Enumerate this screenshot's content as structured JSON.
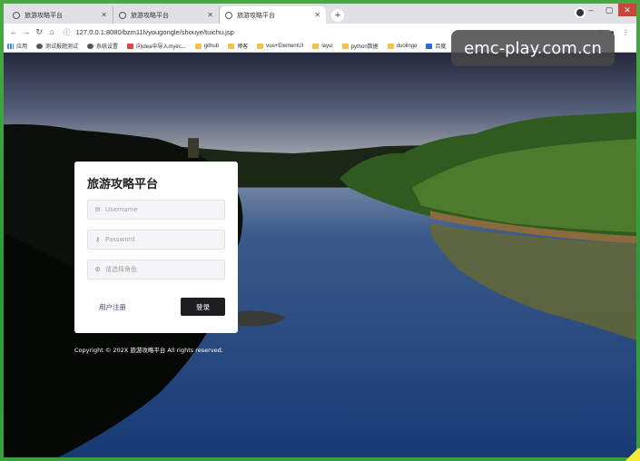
{
  "browser": {
    "tabs": [
      {
        "title": "旅游攻略平台",
        "active": false
      },
      {
        "title": "旅游攻略平台",
        "active": false
      },
      {
        "title": "旅游攻略平台",
        "active": true
      }
    ],
    "new_tab_glyph": "+",
    "url": "127.0.0.1:8080/bzm11lvyougongle/shouye/tuichu.jsp",
    "bookmarks": [
      {
        "label": "应用",
        "icon": "apps-icon"
      },
      {
        "label": "测试报题测试",
        "icon": "globe-icon"
      },
      {
        "label": "系统设置",
        "icon": "page-icon"
      },
      {
        "label": "向idea中导入myec...",
        "icon": "red-icon"
      },
      {
        "label": "github",
        "icon": "folder-icon"
      },
      {
        "label": "博客",
        "icon": "folder-icon"
      },
      {
        "label": "vue+ElementUI",
        "icon": "folder-icon"
      },
      {
        "label": "layui",
        "icon": "folder-icon"
      },
      {
        "label": "python数据",
        "icon": "folder-icon"
      },
      {
        "label": "duolingo",
        "icon": "folder-icon"
      },
      {
        "label": "百度",
        "icon": "blue-icon"
      }
    ]
  },
  "watermark": "emc-play.com.cn",
  "login": {
    "title": "旅游攻略平台",
    "username_placeholder": "Username",
    "password_placeholder": "Password",
    "role_placeholder": "请选择角色",
    "register_label": "用户注册",
    "login_label": "登录"
  },
  "footer": {
    "copyright": "Copyright © 202X 旅游攻略平台 All rights reserved."
  },
  "colors": {
    "frame": "#3a9e3c",
    "login_button": "#1e1e22",
    "register_link": "#4a3f7a"
  }
}
